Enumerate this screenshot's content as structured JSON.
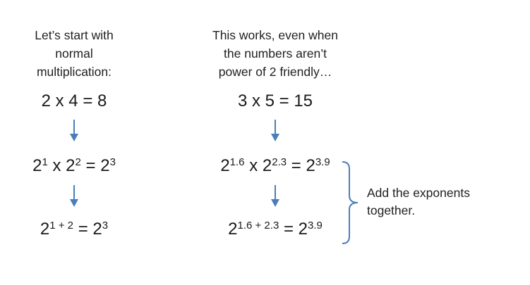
{
  "left": {
    "caption": [
      "Let’s start with",
      "normal",
      "multiplication:"
    ],
    "eq1": "2 x 4 = 8",
    "eq2": {
      "b1": "2",
      "e1": "1",
      "op": " x ",
      "b2": "2",
      "e2": "2",
      "eq": " = ",
      "b3": "2",
      "e3": "3"
    },
    "eq3": {
      "b1": "2",
      "e1": "1 + 2",
      "eq": " = ",
      "b2": "2",
      "e2": "3"
    }
  },
  "middle": {
    "caption": [
      "This works, even when",
      "the numbers aren’t",
      "power of 2 friendly…"
    ],
    "eq1": "3 x 5 = 15",
    "eq2": {
      "b1": "2",
      "e1": "1.6",
      "op": " x ",
      "b2": "2",
      "e2": "2.3",
      "eq": " = ",
      "b3": "2",
      "e3": "3.9"
    },
    "eq3": {
      "b1": "2",
      "e1": "1.6 + 2.3",
      "eq": " = ",
      "b2": "2",
      "e2": "3.9"
    }
  },
  "note": [
    "Add the exponents",
    "together."
  ],
  "colors": {
    "arrow": "#4a7ebb",
    "bracket": "#4a7ebb",
    "text": "#1a1a1a"
  },
  "icons": {
    "arrow": "down-arrow-icon",
    "bracket": "right-brace-icon"
  }
}
